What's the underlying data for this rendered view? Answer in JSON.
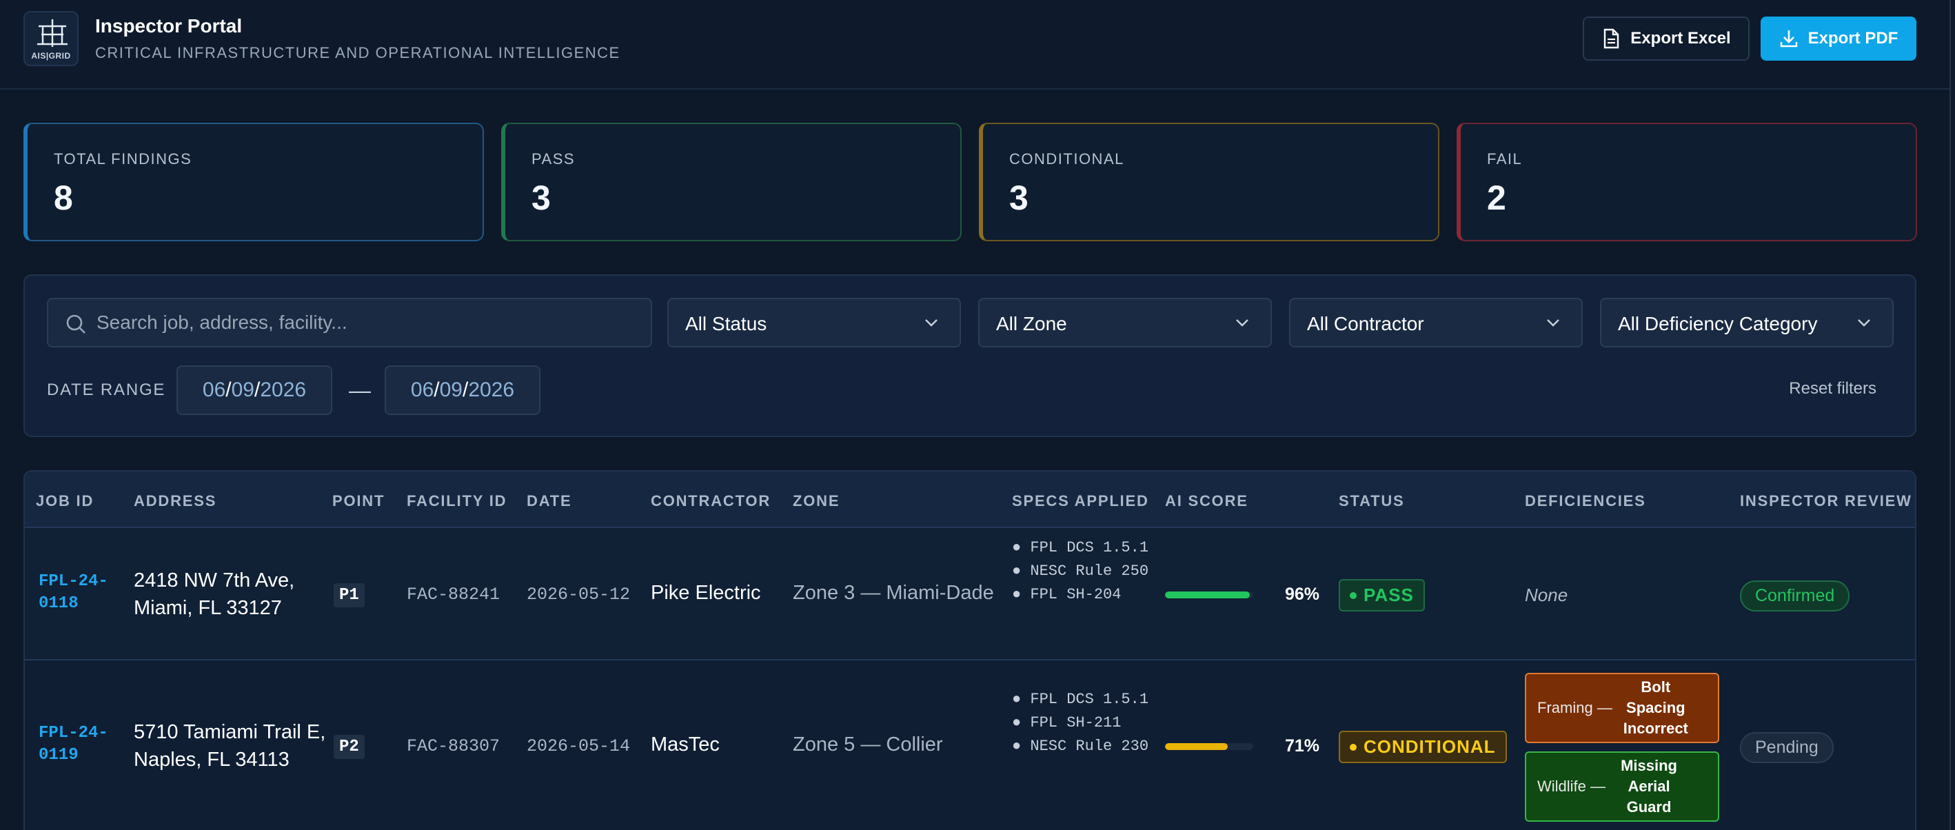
{
  "header": {
    "logo_text": "AIS|GRID",
    "title": "Inspector Portal",
    "subtitle": "CRITICAL INFRASTRUCTURE AND OPERATIONAL INTELLIGENCE",
    "export_excel": "Export Excel",
    "export_pdf": "Export PDF"
  },
  "stats": {
    "total": {
      "label": "TOTAL FINDINGS",
      "value": "8"
    },
    "pass": {
      "label": "PASS",
      "value": "3"
    },
    "conditional": {
      "label": "CONDITIONAL",
      "value": "3"
    },
    "fail": {
      "label": "FAIL",
      "value": "2"
    }
  },
  "filters": {
    "search_placeholder": "Search job, address, facility...",
    "status": "All Status",
    "zone": "All Zone",
    "contractor": "All Contractor",
    "deficiency": "All Deficiency Category",
    "date_range_label": "DATE RANGE",
    "date_from": {
      "mm": "06",
      "dd": "09",
      "yyyy": "2026"
    },
    "date_to": {
      "mm": "06",
      "dd": "09",
      "yyyy": "2026"
    },
    "date_sep": "/",
    "range_dash": "—",
    "reset": "Reset filters"
  },
  "table": {
    "columns": [
      "JOB ID",
      "ADDRESS",
      "POINT",
      "FACILITY ID",
      "DATE",
      "CONTRACTOR",
      "ZONE",
      "SPECS APPLIED",
      "AI SCORE",
      "STATUS",
      "DEFICIENCIES",
      "INSPECTOR REVIEW"
    ],
    "rows": [
      {
        "job_id": "FPL-24-0118",
        "address": "2418 NW 7th Ave, Miami, FL 33127",
        "point": "P1",
        "facility_id": "FAC-88241",
        "date": "2026-05-12",
        "contractor": "Pike Electric",
        "zone": "Zone 3 — Miami-Dade",
        "specs": [
          "FPL DCS 1.5.1",
          "NESC Rule 250",
          "FPL SH-204"
        ],
        "ai_score": "96%",
        "ai_score_value": 96,
        "status": "PASS",
        "deficiencies_none": "None",
        "review": "Confirmed"
      },
      {
        "job_id": "FPL-24-0119",
        "address": "5710 Tamiami Trail E, Naples, FL 34113",
        "point": "P2",
        "facility_id": "FAC-88307",
        "date": "2026-05-14",
        "contractor": "MasTec",
        "zone": "Zone 5 — Collier",
        "specs": [
          "FPL DCS 1.5.1",
          "FPL SH-211",
          "NESC Rule 230"
        ],
        "ai_score": "71%",
        "ai_score_value": 71,
        "status": "CONDITIONAL",
        "deficiencies": [
          {
            "category": "Framing",
            "sep": "—",
            "description": "Bolt Spacing Incorrect"
          },
          {
            "category": "Wildlife",
            "sep": "—",
            "description": "Missing Aerial Guard"
          }
        ],
        "review": "Pending"
      }
    ]
  },
  "colors": {
    "accent": "#0ea5e9",
    "pass": "#22c55e",
    "conditional": "#facc15",
    "fail": "#ef4444"
  }
}
